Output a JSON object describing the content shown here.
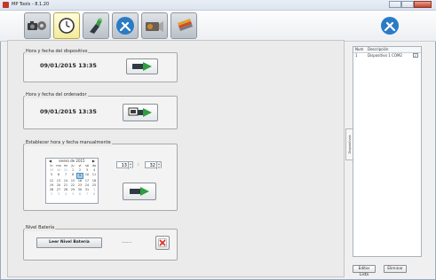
{
  "window": {
    "title": "MP Tools - 8.1.20",
    "controls": [
      "minimize",
      "maximize",
      "close"
    ]
  },
  "toolbar": {
    "tabs": [
      {
        "name": "camera-settings",
        "icon": "camera-gear-icon",
        "active": false
      },
      {
        "name": "date-time",
        "icon": "clock-icon",
        "active": true
      },
      {
        "name": "device-config",
        "icon": "device-icon",
        "active": false
      },
      {
        "name": "tools",
        "icon": "wrench-screwdriver-icon",
        "active": false
      },
      {
        "name": "projector",
        "icon": "projector-icon",
        "active": false
      },
      {
        "name": "paint",
        "icon": "paint-brush-icon",
        "active": false
      }
    ],
    "right_icon": "tools-icon"
  },
  "device_time": {
    "legend": "Hora y fecha del dispositivo",
    "value": "09/01/2015  13:35"
  },
  "pc_time": {
    "legend": "Hora y fecha del ordenador",
    "value": "09/01/2015  13:35"
  },
  "manual_time": {
    "legend": "Establecer hora y fecha manualmente",
    "calendar": {
      "month": "enero de 2015",
      "days_header": [
        "lu",
        "ma",
        "mi",
        "ju",
        "vi",
        "sá",
        "do"
      ],
      "weeks": [
        [
          "29",
          "30",
          "31",
          "1",
          "2",
          "3",
          "4"
        ],
        [
          "5",
          "6",
          "7",
          "8",
          "9",
          "10",
          "11"
        ],
        [
          "12",
          "13",
          "14",
          "15",
          "16",
          "17",
          "18"
        ],
        [
          "19",
          "20",
          "21",
          "22",
          "23",
          "24",
          "25"
        ],
        [
          "26",
          "27",
          "28",
          "29",
          "30",
          "31",
          "1"
        ],
        [
          "2",
          "3",
          "4",
          "5",
          "6",
          "7",
          "8"
        ]
      ],
      "selected": "9"
    },
    "hour": "13",
    "separator": ":",
    "minute": "32"
  },
  "battery": {
    "legend": "Nivel Batería",
    "read_label": "Leer Nivel Batería",
    "value": "--------"
  },
  "side_panel": {
    "vertical_tab": "Dispositivos",
    "columns": [
      "Num",
      "Descripción"
    ],
    "rows": [
      {
        "num": "1",
        "desc": "Dispositivo 1 COM2"
      }
    ],
    "edit_label": "Editar Lista",
    "delete_label": "Eliminar"
  },
  "colors": {
    "accent_green": "#2e9e3e",
    "error_red": "#d9302a",
    "active_tab": "#f3ea9a",
    "calendar_selected": "#9fd0f2"
  }
}
